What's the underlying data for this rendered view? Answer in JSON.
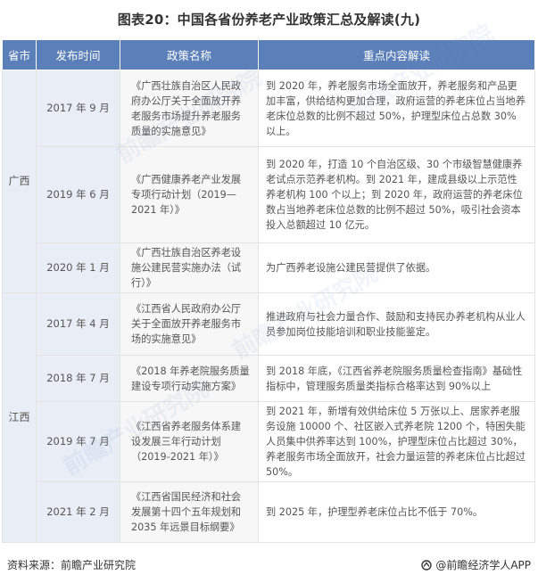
{
  "title": "图表20：中国各省份养老产业政策汇总及解读(九)",
  "headers": {
    "province": "省市",
    "date": "发布时间",
    "policy": "政策名称",
    "interpretation": "重点内容解读"
  },
  "rows": [
    {
      "province": "广西",
      "date": "2017 年 9 月",
      "policy": "《广西壮族自治区人民政府办公厅关于全面放开养老服务市场提升养老服务质量的实施意见》",
      "interpretation": "到 2020 年，养老服务市场全面放开，养老服务和产品更加丰富，供给结构更加合理，政府运营的养老床位占当地养老床位总数的比例不超过 50%，护理型床位占总数 30%以上。"
    },
    {
      "province": "",
      "date": "2019 年 6 月",
      "policy": "《广西健康养老产业发展专项行动计划（2019—2021 年）》",
      "interpretation": "到 2020 年，打造 10 个自治区级、30 个市级智慧健康养老试点示范养老机构。到 2021 年，建成县级以上示范性养老机构 100 个以上；到 2020 年，政府运营的养老床位数占当地养老床位总数的比例不超过 50%，吸引社会资本投入总额超过 10 亿元。"
    },
    {
      "province": "",
      "date": "2020 年 1 月",
      "policy": "《广西壮族自治区养老设施公建民营实施办法（试行）》",
      "interpretation": "为广西养老设施公建民营提供了依据。"
    },
    {
      "province": "江西",
      "date": "2017 年 4 月",
      "policy": "《江西省人民政府办公厅关于全面放开养老服务市场的实施意见》",
      "interpretation": "推进政府与社会力量合作、鼓励和支持民办养老机构从业人员参加岗位技能培训和职业技能鉴定。"
    },
    {
      "province": "",
      "date": "2018 年 7 月",
      "policy": "《2018 年养老院服务质量建设专项行动实施方案》",
      "interpretation": "到 2018 年底，《江西省养老院服务质量检查指南》基础性指标中，管理服务质量类指标合格率达到 90%以上"
    },
    {
      "province": "",
      "date": "2019 年 7 月",
      "policy": "《江西省养老服务体系建设发展三年行动计划（2019-2021 年）》",
      "interpretation": "到 2021 年，新增有效供给床位 5 万张以上、居家养老服务设施 10000 个、社区嵌入式养老院 1200 个，特困失能人员集中供养率达到 100%，护理型床位占比超过 30%，养老服务市场全面放开，社会力量运营的养老床位占比超过 50%。"
    },
    {
      "province": "",
      "date": "2021 年 2 月",
      "policy": "《江西省国民经济和社会发展第十四个五年规划和 2035 年远景目标纲要》",
      "interpretation": "到 2025 年，护理型养老床位占比不低于 70%。"
    }
  ],
  "footer": {
    "source": "资料来源：前瞻产业研究院",
    "brand": "@前瞻经济学人APP",
    "logo_icon": "qianzhan-logo-icon"
  },
  "watermark": "前瞻产业研究院"
}
